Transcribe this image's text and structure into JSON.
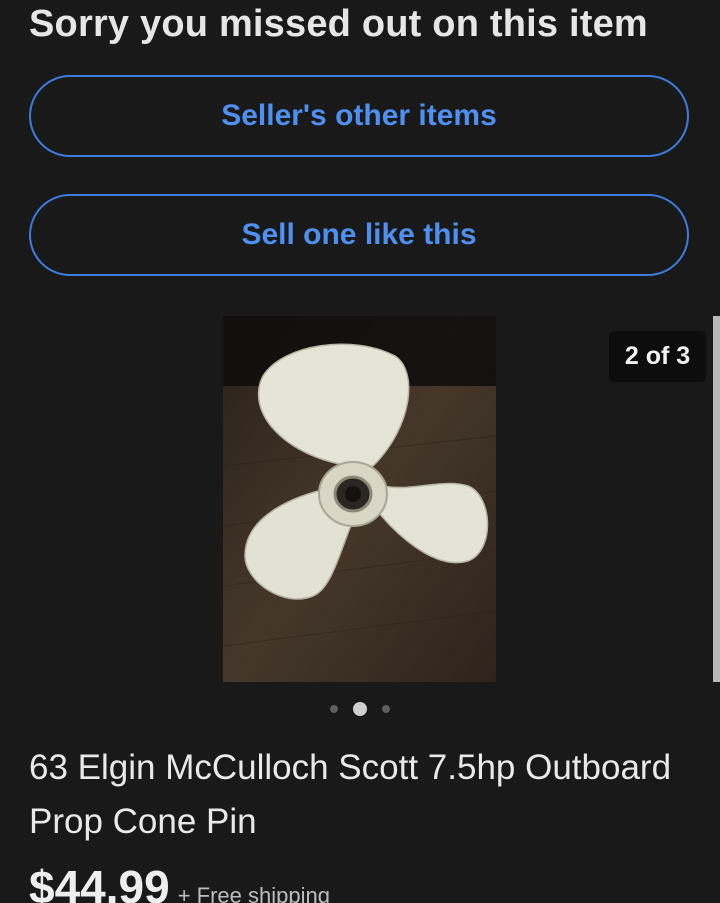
{
  "notice": {
    "headline": "Sorry you missed out on this item"
  },
  "actions": {
    "sellers_other_items": "Seller's other items",
    "sell_one_like_this": "Sell one like this"
  },
  "gallery": {
    "counter": "2 of 3",
    "image_subject": "white three-blade outboard propeller on wooden surface",
    "current_index": 2,
    "total": 3
  },
  "listing": {
    "title": "63 Elgin McCulloch Scott 7.5hp Outboard Prop Cone Pin",
    "price": "$44.99",
    "shipping": "+ Free shipping"
  },
  "colors": {
    "background": "#191919",
    "accent_blue": "#4f8ff0",
    "button_border": "#3b7cdc"
  }
}
